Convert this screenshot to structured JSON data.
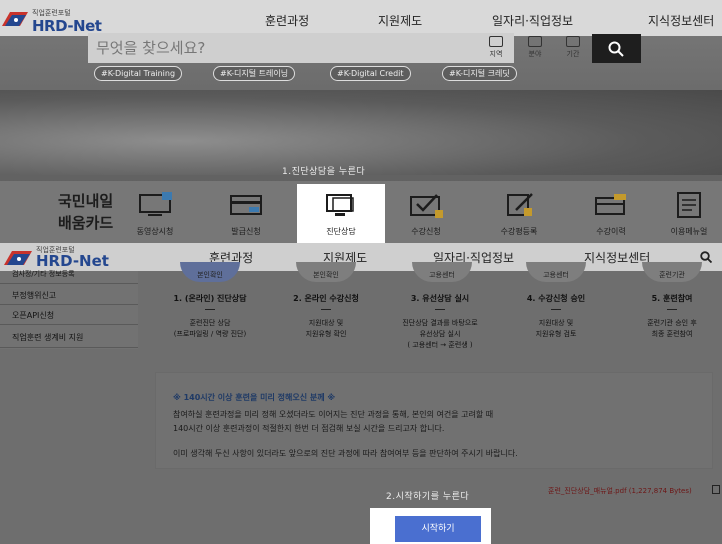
{
  "top": {
    "logo_tag": "직업훈련포털",
    "logo_name": "HRD-Net",
    "menu": [
      "훈련과정",
      "지원제도",
      "일자리·직업정보",
      "지식정보센터"
    ],
    "search_placeholder": "무엇을 찾으세요?",
    "filters": [
      "지역",
      "분야",
      "기간"
    ],
    "hashtags": [
      "#K-Digital Training",
      "#K-디지털 트레이닝",
      "#K-Digital Credit",
      "#K-디지털 크레딧"
    ],
    "annotation1": "1.진단상담을 누른다",
    "card_title_line1": "국민내일",
    "card_title_line2": "배움카드",
    "services": [
      "동영상시청",
      "발급신청",
      "진단상담",
      "수강신청",
      "수강평등록",
      "수강이력",
      "이용메뉴얼"
    ]
  },
  "second": {
    "logo_tag": "직업훈련포털",
    "logo_name": "HRD-Net",
    "menu": [
      "훈련과정",
      "지원제도",
      "일자리·직업정보",
      "지식정보센터"
    ]
  },
  "side": {
    "items": [
      "검사정/기타 정보등록",
      "부정행위신고",
      "오픈API신청",
      "직업훈련 생계비 지원"
    ]
  },
  "steps": [
    {
      "circle": "본인확인",
      "title": "1. (온라인) 진단상담",
      "desc1": "훈련진단 상담",
      "desc2": "(프로파일링 / 역량 진단)",
      "desc3": ""
    },
    {
      "circle": "본인확인",
      "title": "2. 온라인 수강신청",
      "desc1": "지원대상 및",
      "desc2": "지원유형 확인",
      "desc3": ""
    },
    {
      "circle": "고용센터",
      "title": "3. 유선상담 실시",
      "desc1": "진단상담 결과를 바탕으로",
      "desc2": "유선상담 실시",
      "desc3": "( 고용센터 → 훈련생 )"
    },
    {
      "circle": "고용센터",
      "title": "4. 수강신청 승인",
      "desc1": "지원대상 및",
      "desc2": "지원유형 검토",
      "desc3": ""
    },
    {
      "circle": "훈련기관",
      "title": "5. 훈련참여",
      "desc1": "훈련기관 승인 후",
      "desc2": "최종 훈련참여",
      "desc3": ""
    }
  ],
  "notice": {
    "title": "※ 140시간 이상 훈련을 미리 정해오신 분께 ※",
    "line1": "참여하실 훈련과정을 미리 정해 오셨더라도 이어지는 진단 과정을 통해, 본인의 여건을 고려할 때",
    "line2": "140시간 이상 훈련과정이 적절한지 한번 더 점검해 보실 시간을 드리고자 합니다.",
    "line3": "이미 생각해 두신 사항이 있더라도 앞으로의 진단 과정에 따라 참여여부 등을 판단하여 주시기 바랍니다."
  },
  "annotation2": "2.시작하기를 누른다",
  "file_link": "훈련_진단상담_매뉴얼.pdf (1,227,874 Bytes)",
  "start_button": "시작하기",
  "colors": {
    "brand": "#24478f",
    "start_button": "#4a6fd0",
    "file_link": "#6d1616",
    "notice_title": "#1f3a66"
  }
}
